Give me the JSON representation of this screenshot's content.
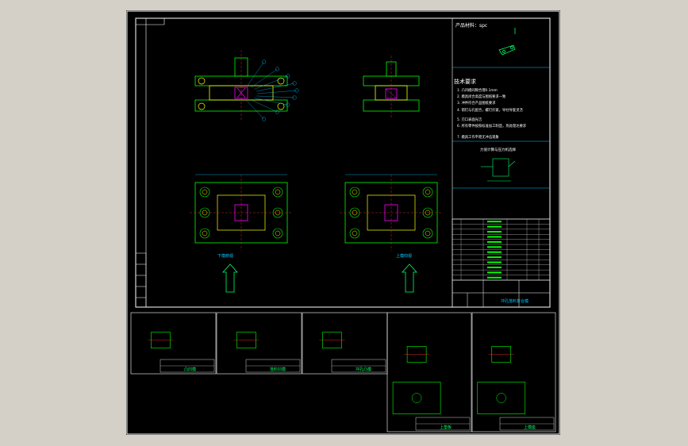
{
  "drawing": {
    "product_line": "产品材料：spc",
    "tech_title": "技术要求",
    "tech_items": [
      "1. 凸凹模间隙合理0.1mm",
      "2. 模具闭合高度与图纸要求一致",
      "3. 冲件符合产品图纸要求",
      "4. 销钉与孔配合，螺钉拧紧，导柱导套灵活",
      "5. 刃口表面光洁",
      "6. 所有零件按照标准加工制造，热处理达要求",
      "7. 模具工作平稳无冲击现象"
    ],
    "force_table_title": "力值计算与压力机选择",
    "view_labels": [
      "下模俯视",
      "上模仰视"
    ],
    "main_title": "冲孔落料复合模",
    "sub_sheets": [
      {
        "title": "凸凹模"
      },
      {
        "title": "落料凹模"
      },
      {
        "title": "冲孔凸模"
      },
      {
        "title": "上垫板"
      },
      {
        "title": "上模座"
      }
    ]
  },
  "colors": {
    "background": "#000000",
    "frame": "#ffffff",
    "part_green": "#00ff00",
    "part_yellow": "#ffff00",
    "part_magenta": "#ff00ff",
    "dimension_cyan": "#00c8ff",
    "centerline_red": "#ff3030"
  }
}
